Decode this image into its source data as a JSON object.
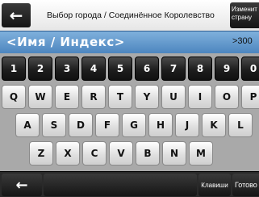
{
  "header": {
    "back_glyph": "←",
    "title": "Выбор города / Соединённое Королевство",
    "change_country_line1": "Изменит",
    "change_country_line2": "страну"
  },
  "search": {
    "placeholder": "<Имя / Индекс>",
    "counter": ">300"
  },
  "keyboard": {
    "row1": [
      "1",
      "2",
      "3",
      "4",
      "5",
      "6",
      "7",
      "8",
      "9",
      "0"
    ],
    "row2": [
      "Q",
      "W",
      "E",
      "R",
      "T",
      "Y",
      "U",
      "I",
      "O",
      "P"
    ],
    "row3": [
      "A",
      "S",
      "D",
      "F",
      "G",
      "H",
      "J",
      "K",
      "L"
    ],
    "row4": [
      "Z",
      "X",
      "C",
      "V",
      "B",
      "N",
      "M"
    ]
  },
  "bottom": {
    "back_glyph": "←",
    "keys_label": "Клавиши",
    "done_label": "Готово"
  },
  "colors": {
    "input_bg": "#5b95cc",
    "key_dark": "#1e1e1e",
    "key_light": "#ffffff"
  }
}
